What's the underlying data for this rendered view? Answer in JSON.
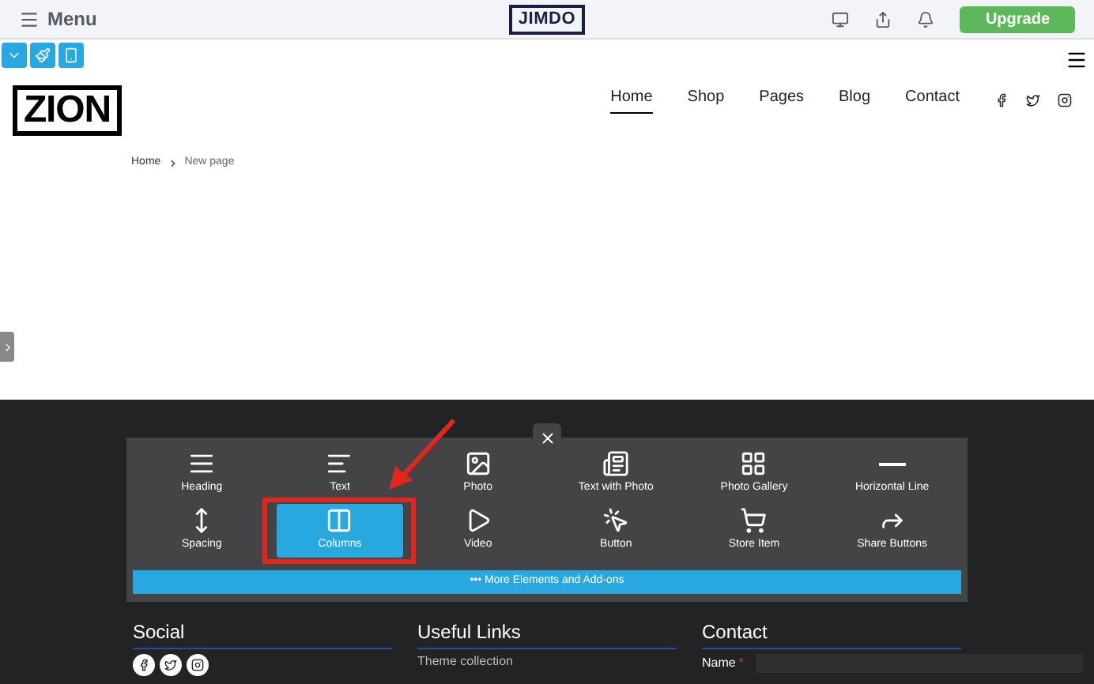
{
  "topbar": {
    "menu_label": "Menu",
    "logo": "JIMDO",
    "upgrade_button": "Upgrade"
  },
  "site": {
    "logo": "ZION",
    "nav": [
      {
        "label": "Home",
        "selected": true
      },
      {
        "label": "Shop",
        "selected": false
      },
      {
        "label": "Pages",
        "selected": false
      },
      {
        "label": "Blog",
        "selected": false
      },
      {
        "label": "Contact",
        "selected": false
      }
    ],
    "breadcrumb": [
      "Home",
      "New page"
    ]
  },
  "element_panel": {
    "items": [
      {
        "label": "Heading",
        "selected": false
      },
      {
        "label": "Text",
        "selected": false
      },
      {
        "label": "Photo",
        "selected": false
      },
      {
        "label": "Text with Photo",
        "selected": false
      },
      {
        "label": "Photo Gallery",
        "selected": false
      },
      {
        "label": "Horizontal Line",
        "selected": false
      },
      {
        "label": "Spacing",
        "selected": false
      },
      {
        "label": "Columns",
        "selected": true
      },
      {
        "label": "Video",
        "selected": false
      },
      {
        "label": "Button",
        "selected": false
      },
      {
        "label": "Store Item",
        "selected": false
      },
      {
        "label": "Share Buttons",
        "selected": false
      }
    ],
    "more_button": "••• More Elements and Add-ons"
  },
  "footer": {
    "columns": [
      {
        "heading": "Social",
        "kind": "social"
      },
      {
        "heading": "Useful Links",
        "kind": "links",
        "links": [
          "Theme collection"
        ]
      },
      {
        "heading": "Contact",
        "kind": "form",
        "field_label": "Name",
        "required_mark": "*"
      }
    ]
  }
}
